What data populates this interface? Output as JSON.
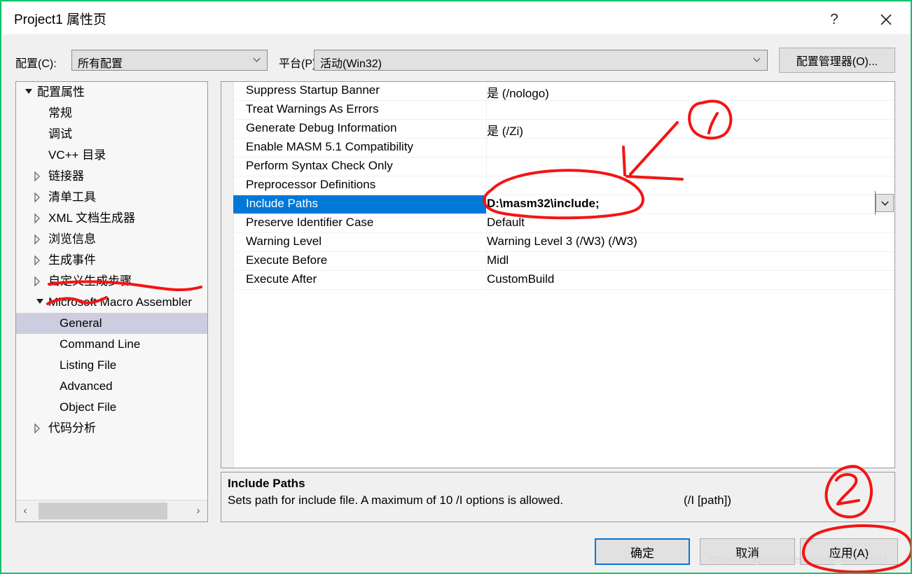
{
  "window": {
    "title": "Project1 属性页",
    "help_icon": "?",
    "close_icon": "close-icon",
    "border_color": "#13c26b"
  },
  "config_bar": {
    "configuration_label": "配置(C):",
    "configuration_value": "所有配置",
    "platform_label": "平台(P):",
    "platform_value": "活动(Win32)",
    "config_manager_button": "配置管理器(O)..."
  },
  "tree": {
    "selected": "General",
    "selection_color": "#cdcddf",
    "items": [
      {
        "label": "配置属性",
        "indent": 0,
        "state": "expanded"
      },
      {
        "label": "常规",
        "indent": 1,
        "state": "leaf"
      },
      {
        "label": "调试",
        "indent": 1,
        "state": "leaf"
      },
      {
        "label": "VC++ 目录",
        "indent": 1,
        "state": "leaf"
      },
      {
        "label": "链接器",
        "indent": 1,
        "state": "collapsed"
      },
      {
        "label": "清单工具",
        "indent": 1,
        "state": "collapsed"
      },
      {
        "label": "XML 文档生成器",
        "indent": 1,
        "state": "collapsed"
      },
      {
        "label": "浏览信息",
        "indent": 1,
        "state": "collapsed"
      },
      {
        "label": "生成事件",
        "indent": 1,
        "state": "collapsed"
      },
      {
        "label": "自定义生成步骤",
        "indent": 1,
        "state": "collapsed"
      },
      {
        "label": "Microsoft Macro Assembler",
        "indent": 1,
        "state": "expanded"
      },
      {
        "label": "General",
        "indent": 2,
        "state": "leaf",
        "selected": true
      },
      {
        "label": "Command Line",
        "indent": 2,
        "state": "leaf"
      },
      {
        "label": "Listing File",
        "indent": 2,
        "state": "leaf"
      },
      {
        "label": "Advanced",
        "indent": 2,
        "state": "leaf"
      },
      {
        "label": "Object File",
        "indent": 2,
        "state": "leaf"
      },
      {
        "label": "代码分析",
        "indent": 1,
        "state": "collapsed"
      }
    ],
    "scrollbar": {
      "left_arrow": "‹",
      "right_arrow": "›"
    }
  },
  "grid": {
    "selected_row": 6,
    "selection_color": "#0078d7",
    "rows": [
      {
        "name": "Suppress Startup Banner",
        "value": "是 (/nologo)"
      },
      {
        "name": "Treat Warnings As Errors",
        "value": ""
      },
      {
        "name": "Generate Debug Information",
        "value": "是 (/Zi)"
      },
      {
        "name": "Enable MASM 5.1 Compatibility",
        "value": ""
      },
      {
        "name": "Perform Syntax Check Only",
        "value": ""
      },
      {
        "name": "Preprocessor Definitions",
        "value": ""
      },
      {
        "name": "Include Paths",
        "value": "D:\\masm32\\include;"
      },
      {
        "name": "Preserve Identifier Case",
        "value": "Default"
      },
      {
        "name": "Warning Level",
        "value": "Warning Level 3 (/W3) (/W3)"
      },
      {
        "name": "Execute Before",
        "value": "Midl"
      },
      {
        "name": "Execute After",
        "value": "CustomBuild"
      }
    ],
    "edit_dropdown_icon": "chevron-down-icon"
  },
  "description": {
    "title": "Include Paths",
    "body": "Sets path for include file. A maximum of 10 /I options is allowed.",
    "switch": "(/I [path])"
  },
  "buttons": {
    "ok": "确定",
    "cancel": "取消",
    "apply": "应用(A)"
  },
  "watermark": "https://blog.csdn.net/weixin_42430021",
  "annotations": {
    "ink_color": "#f41414",
    "marks": [
      {
        "type": "circled-number",
        "label": "1",
        "target": "include-paths-value"
      },
      {
        "type": "arrow",
        "target": "include-paths-value"
      },
      {
        "type": "oval",
        "target": "include-paths-value"
      },
      {
        "type": "squiggle-underline",
        "target": "tree-item-general"
      },
      {
        "type": "circled-number",
        "label": "2",
        "target": "apply-button"
      },
      {
        "type": "oval",
        "target": "apply-button"
      }
    ]
  }
}
